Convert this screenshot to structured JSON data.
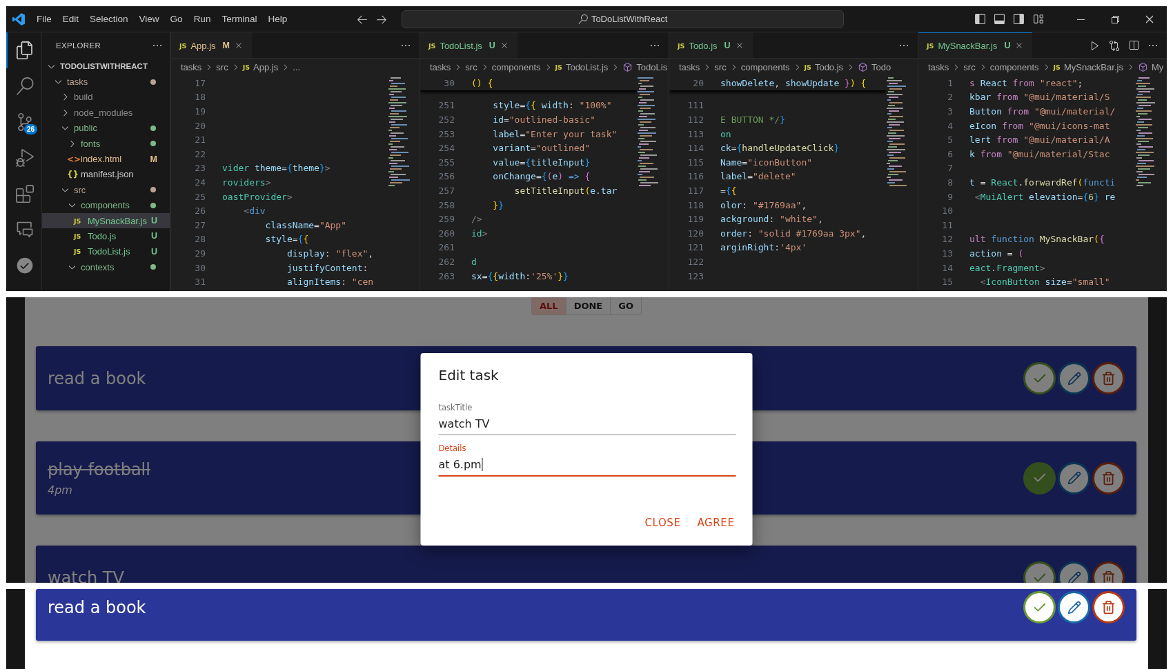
{
  "title_bar": {
    "menu": [
      "File",
      "Edit",
      "Selection",
      "View",
      "Go",
      "Run",
      "Terminal",
      "Help"
    ],
    "search": "ToDoListWithReact"
  },
  "activity_bar": {
    "items": [
      {
        "kind": "explorer",
        "selected": true
      },
      {
        "kind": "search",
        "selected": false
      },
      {
        "kind": "source-control",
        "selected": false,
        "badge": "26"
      },
      {
        "kind": "run",
        "selected": false
      },
      {
        "kind": "extensions",
        "selected": false
      },
      {
        "kind": "remote",
        "selected": false
      },
      {
        "kind": "testing",
        "selected": false
      }
    ]
  },
  "explorer": {
    "title": "EXPLORER",
    "tree": [
      {
        "label": "TODOLISTWITHREACT",
        "kind": "root",
        "expanded": true,
        "selected": false,
        "children": [
          {
            "label": "tasks",
            "kind": "folder",
            "expanded": true,
            "selected": false,
            "dot": true,
            "color": "#b8a394",
            "children": [
              {
                "label": "build",
                "kind": "folder",
                "expanded": false,
                "selected": false,
                "color": "#8c8c8c"
              },
              {
                "label": "node_modules",
                "kind": "folder",
                "expanded": false,
                "selected": false,
                "color": "#8c8c8c"
              },
              {
                "label": "public",
                "kind": "folder",
                "expanded": true,
                "selected": false,
                "dot": true,
                "color": "#81b88b",
                "children": [
                  {
                    "label": "fonts",
                    "kind": "folder",
                    "expanded": false,
                    "selected": false,
                    "dot": true,
                    "color": "#81b88b"
                  },
                  {
                    "label": "index.html",
                    "kind": "html",
                    "glyph": "<>",
                    "selected": false,
                    "badge": "M",
                    "color": "#e2c08d"
                  },
                  {
                    "label": "manifest.json",
                    "kind": "json",
                    "glyph": "{}",
                    "selected": false,
                    "color": "#cccccc"
                  }
                ]
              },
              {
                "label": "src",
                "kind": "folder",
                "expanded": true,
                "selected": false,
                "dot": true,
                "color": "#b8a394",
                "children": [
                  {
                    "label": "components",
                    "kind": "folder",
                    "expanded": true,
                    "selected": false,
                    "dot": true,
                    "color": "#81b88b",
                    "children": [
                      {
                        "label": "MySnackBar.js",
                        "kind": "js",
                        "glyph": "JS",
                        "selected": true,
                        "badge": "U",
                        "color": "#73c991"
                      },
                      {
                        "label": "Todo.js",
                        "kind": "js",
                        "glyph": "JS",
                        "selected": false,
                        "badge": "U",
                        "color": "#73c991"
                      },
                      {
                        "label": "TodoList.js",
                        "kind": "js",
                        "glyph": "JS",
                        "selected": false,
                        "badge": "U",
                        "color": "#73c991"
                      }
                    ]
                  },
                  {
                    "label": "contexts",
                    "kind": "folder",
                    "expanded": true,
                    "selected": false,
                    "dot": true,
                    "color": "#81b88b"
                  }
                ]
              }
            ]
          }
        ]
      }
    ]
  },
  "editor_groups": [
    {
      "focused": false,
      "tab": {
        "glyph": "JS",
        "label": "App.js",
        "badge": "M",
        "color": "#e2c08d",
        "selected": true
      },
      "actions": [
        {
          "kind": "more"
        }
      ],
      "breadcrumbs": [
        {
          "label": "tasks",
          "kind": "folder"
        },
        {
          "label": "src",
          "kind": "folder"
        },
        {
          "label": "App.js",
          "kind": "file",
          "glyph": "JS"
        },
        {
          "label": "...",
          "kind": "more"
        }
      ],
      "lines": [
        {
          "number": "17"
        },
        {
          "number": "18"
        },
        {
          "number": "19"
        },
        {
          "number": "20"
        },
        {
          "number": "21"
        },
        {
          "number": "22"
        },
        {
          "number": "23",
          "tokens": [
            {
              "text": "vider",
              "kind": "type"
            },
            {
              "text": " theme",
              "kind": "var"
            },
            {
              "text": "=",
              "kind": "plain"
            },
            {
              "text": "{",
              "kind": "brace3"
            },
            {
              "text": "theme",
              "kind": "var"
            },
            {
              "text": "}",
              "kind": "brace3"
            },
            {
              "text": ">",
              "kind": "punct"
            }
          ]
        },
        {
          "number": "24",
          "tokens": [
            {
              "text": "roviders",
              "kind": "type"
            },
            {
              "text": ">",
              "kind": "punct"
            }
          ]
        },
        {
          "number": "25",
          "tokens": [
            {
              "text": "oastProvider",
              "kind": "type"
            },
            {
              "text": ">",
              "kind": "punct"
            }
          ]
        },
        {
          "number": "26",
          "tokens": [
            {
              "text": "    <",
              "kind": "punct"
            },
            {
              "text": "div",
              "kind": "tag"
            }
          ]
        },
        {
          "number": "27",
          "tokens": [
            {
              "text": "        className",
              "kind": "var"
            },
            {
              "text": "=",
              "kind": "plain"
            },
            {
              "text": "\"App\"",
              "kind": "str"
            }
          ]
        },
        {
          "number": "28",
          "tokens": [
            {
              "text": "        style",
              "kind": "var"
            },
            {
              "text": "=",
              "kind": "plain"
            },
            {
              "text": "{",
              "kind": "brace3"
            },
            {
              "text": "{",
              "kind": "brace1"
            }
          ]
        },
        {
          "number": "29",
          "tokens": [
            {
              "text": "            display",
              "kind": "var"
            },
            {
              "text": ": ",
              "kind": "plain"
            },
            {
              "text": "\"flex\"",
              "kind": "str"
            },
            {
              "text": ",",
              "kind": "plain"
            }
          ]
        },
        {
          "number": "30",
          "tokens": [
            {
              "text": "            justifyContent",
              "kind": "var"
            },
            {
              "text": ":",
              "kind": "plain"
            }
          ]
        },
        {
          "number": "31",
          "tokens": [
            {
              "text": "            alignItems",
              "kind": "var"
            },
            {
              "text": ": ",
              "kind": "plain"
            },
            {
              "text": "\"cen",
              "kind": "str"
            }
          ]
        }
      ]
    },
    {
      "focused": false,
      "tab": {
        "glyph": "JS",
        "label": "TodoList.js",
        "badge": "U",
        "color": "#73c991",
        "selected": true
      },
      "actions": [
        {
          "kind": "more"
        }
      ],
      "breadcrumbs": [
        {
          "label": "tasks",
          "kind": "folder"
        },
        {
          "label": "src",
          "kind": "folder"
        },
        {
          "label": "components",
          "kind": "folder"
        },
        {
          "label": "TodoList.js",
          "kind": "file",
          "glyph": "JS"
        },
        {
          "label": "TodoLis",
          "kind": "symbol"
        }
      ],
      "sticky_line": {
        "number": "30",
        "tokens": [
          {
            "text": "() {",
            "kind": "brace1"
          }
        ]
      },
      "lines": [
        {
          "number": "251",
          "tokens": [
            {
              "text": "    style",
              "kind": "var"
            },
            {
              "text": "=",
              "kind": "plain"
            },
            {
              "text": "{",
              "kind": "brace3"
            },
            {
              "text": "{",
              "kind": "brace1"
            },
            {
              "text": " width",
              "kind": "var"
            },
            {
              "text": ": ",
              "kind": "plain"
            },
            {
              "text": "\"100%\"",
              "kind": "str"
            }
          ]
        },
        {
          "number": "252",
          "tokens": [
            {
              "text": "    id",
              "kind": "var"
            },
            {
              "text": "=",
              "kind": "plain"
            },
            {
              "text": "\"outlined-basic\"",
              "kind": "str"
            }
          ]
        },
        {
          "number": "253",
          "tokens": [
            {
              "text": "    label",
              "kind": "var"
            },
            {
              "text": "=",
              "kind": "plain"
            },
            {
              "text": "\"Enter your task\"",
              "kind": "str"
            }
          ]
        },
        {
          "number": "254",
          "tokens": [
            {
              "text": "    variant",
              "kind": "var"
            },
            {
              "text": "=",
              "kind": "plain"
            },
            {
              "text": "\"outlined\"",
              "kind": "str"
            }
          ]
        },
        {
          "number": "255",
          "tokens": [
            {
              "text": "    value",
              "kind": "var"
            },
            {
              "text": "=",
              "kind": "plain"
            },
            {
              "text": "{",
              "kind": "brace3"
            },
            {
              "text": "titleInput",
              "kind": "var"
            },
            {
              "text": "}",
              "kind": "brace3"
            }
          ]
        },
        {
          "number": "256",
          "tokens": [
            {
              "text": "    onChange",
              "kind": "var"
            },
            {
              "text": "=",
              "kind": "plain"
            },
            {
              "text": "{",
              "kind": "brace3"
            },
            {
              "text": "(",
              "kind": "brace2"
            },
            {
              "text": "e",
              "kind": "var"
            },
            {
              "text": ")",
              "kind": "brace2"
            },
            {
              "text": " => ",
              "kind": "kw2"
            },
            {
              "text": "{",
              "kind": "brace2"
            }
          ]
        },
        {
          "number": "257",
          "tokens": [
            {
              "text": "        setTitleInput",
              "kind": "fn"
            },
            {
              "text": "(",
              "kind": "brace1"
            },
            {
              "text": "e.tar",
              "kind": "var"
            }
          ]
        },
        {
          "number": "258",
          "tokens": [
            {
              "text": "    }",
              "kind": "brace1"
            },
            {
              "text": "}",
              "kind": "brace3"
            }
          ]
        },
        {
          "number": "259",
          "tokens": [
            {
              "text": "/>",
              "kind": "punct"
            }
          ]
        },
        {
          "number": "260",
          "tokens": [
            {
              "text": "id",
              "kind": "type"
            },
            {
              "text": ">",
              "kind": "punct"
            }
          ]
        },
        {
          "number": "261"
        },
        {
          "number": "262",
          "tokens": [
            {
              "text": "d",
              "kind": "type"
            }
          ]
        },
        {
          "number": "263",
          "tokens": [
            {
              "text": "sx",
              "kind": "var"
            },
            {
              "text": "=",
              "kind": "plain"
            },
            {
              "text": "{",
              "kind": "brace3"
            },
            {
              "text": "{",
              "kind": "brace1"
            },
            {
              "text": "width",
              "kind": "var"
            },
            {
              "text": ":",
              "kind": "plain"
            },
            {
              "text": "'25%'",
              "kind": "str"
            },
            {
              "text": "}",
              "kind": "brace1"
            },
            {
              "text": "}",
              "kind": "brace3"
            }
          ]
        }
      ]
    },
    {
      "focused": false,
      "tab": {
        "glyph": "JS",
        "label": "Todo.js",
        "badge": "U",
        "color": "#73c991",
        "selected": true
      },
      "actions": [
        {
          "kind": "more"
        }
      ],
      "breadcrumbs": [
        {
          "label": "tasks",
          "kind": "folder"
        },
        {
          "label": "src",
          "kind": "folder"
        },
        {
          "label": "components",
          "kind": "folder"
        },
        {
          "label": "Todo.js",
          "kind": "file",
          "glyph": "JS"
        },
        {
          "label": "Todo",
          "kind": "symbol"
        }
      ],
      "sticky_line": {
        "number": "20",
        "tokens": [
          {
            "text": "showDelete",
            "kind": "var"
          },
          {
            "text": ", ",
            "kind": "plain"
          },
          {
            "text": "showUpdate",
            "kind": "var"
          },
          {
            "text": " }",
            "kind": "brace2"
          },
          {
            "text": ") {",
            "kind": "brace1"
          }
        ]
      },
      "lines": [
        {
          "number": "111"
        },
        {
          "number": "112",
          "tokens": [
            {
              "text": "E BUTTON */",
              "kind": "comment"
            },
            {
              "text": "}",
              "kind": "brace3"
            }
          ]
        },
        {
          "number": "113",
          "tokens": [
            {
              "text": "on",
              "kind": "type"
            }
          ]
        },
        {
          "number": "114",
          "tokens": [
            {
              "text": "ck",
              "kind": "var"
            },
            {
              "text": "=",
              "kind": "plain"
            },
            {
              "text": "{",
              "kind": "brace3"
            },
            {
              "text": "handleUpdateClick",
              "kind": "fn"
            },
            {
              "text": "}",
              "kind": "brace3"
            }
          ]
        },
        {
          "number": "115",
          "tokens": [
            {
              "text": "Name",
              "kind": "var"
            },
            {
              "text": "=",
              "kind": "plain"
            },
            {
              "text": "\"iconButton\"",
              "kind": "str"
            }
          ]
        },
        {
          "number": "116",
          "tokens": [
            {
              "text": "label",
              "kind": "var"
            },
            {
              "text": "=",
              "kind": "plain"
            },
            {
              "text": "\"delete\"",
              "kind": "str"
            }
          ]
        },
        {
          "number": "117",
          "tokens": [
            {
              "text": "=",
              "kind": "plain"
            },
            {
              "text": "{",
              "kind": "brace3"
            },
            {
              "text": "{",
              "kind": "brace1"
            }
          ]
        },
        {
          "number": "118",
          "tokens": [
            {
              "text": "olor",
              "kind": "var"
            },
            {
              "text": ": ",
              "kind": "plain"
            },
            {
              "text": "\"#1769aa\"",
              "kind": "str"
            },
            {
              "text": ",",
              "kind": "plain"
            }
          ]
        },
        {
          "number": "119",
          "tokens": [
            {
              "text": "ackground",
              "kind": "var"
            },
            {
              "text": ": ",
              "kind": "plain"
            },
            {
              "text": "\"white\"",
              "kind": "str"
            },
            {
              "text": ",",
              "kind": "plain"
            }
          ]
        },
        {
          "number": "120",
          "tokens": [
            {
              "text": "order",
              "kind": "var"
            },
            {
              "text": ": ",
              "kind": "plain"
            },
            {
              "text": "\"solid #1769aa 3px\"",
              "kind": "str"
            },
            {
              "text": ",",
              "kind": "plain"
            }
          ]
        },
        {
          "number": "121",
          "tokens": [
            {
              "text": "arginRight",
              "kind": "var"
            },
            {
              "text": ":",
              "kind": "plain"
            },
            {
              "text": "'4px'",
              "kind": "str"
            }
          ]
        },
        {
          "number": "122"
        },
        {
          "number": "123"
        }
      ]
    },
    {
      "focused": true,
      "tab": {
        "glyph": "JS",
        "label": "MySnackBar.js",
        "badge": "U",
        "color": "#73c991",
        "selected": true
      },
      "actions": [
        {
          "kind": "run"
        },
        {
          "kind": "compare"
        },
        {
          "kind": "split"
        },
        {
          "kind": "more"
        }
      ],
      "breadcrumbs": [
        {
          "label": "tasks",
          "kind": "folder"
        },
        {
          "label": "src",
          "kind": "folder"
        },
        {
          "label": "components",
          "kind": "folder"
        },
        {
          "label": "MySnackBar.js",
          "kind": "file",
          "glyph": "JS"
        },
        {
          "label": "My",
          "kind": "symbol"
        }
      ],
      "lines": [
        {
          "number": "1",
          "tokens": [
            {
              "text": "s ",
              "kind": "kw"
            },
            {
              "text": "React",
              "kind": "var"
            },
            {
              "text": " from ",
              "kind": "kw"
            },
            {
              "text": "\"react\"",
              "kind": "str"
            },
            {
              "text": ";",
              "kind": "plain"
            }
          ]
        },
        {
          "number": "2",
          "tokens": [
            {
              "text": "kbar",
              "kind": "var"
            },
            {
              "text": " from ",
              "kind": "kw"
            },
            {
              "text": "\"@mui/material/S",
              "kind": "str"
            }
          ]
        },
        {
          "number": "3",
          "tokens": [
            {
              "text": "Button",
              "kind": "var"
            },
            {
              "text": " from ",
              "kind": "kw"
            },
            {
              "text": "\"@mui/material/",
              "kind": "str"
            }
          ]
        },
        {
          "number": "4",
          "tokens": [
            {
              "text": "eIcon",
              "kind": "var"
            },
            {
              "text": " from ",
              "kind": "kw"
            },
            {
              "text": "\"@mui/icons-mat",
              "kind": "str"
            }
          ]
        },
        {
          "number": "5",
          "tokens": [
            {
              "text": "lert",
              "kind": "var"
            },
            {
              "text": " from ",
              "kind": "kw"
            },
            {
              "text": "\"@mui/material/A",
              "kind": "str"
            }
          ]
        },
        {
          "number": "6",
          "tokens": [
            {
              "text": "k",
              "kind": "var"
            },
            {
              "text": " from ",
              "kind": "kw"
            },
            {
              "text": "\"@mui/material/Stac",
              "kind": "str"
            }
          ]
        },
        {
          "number": "7"
        },
        {
          "number": "8",
          "tokens": [
            {
              "text": "t",
              "kind": "var"
            },
            {
              "text": " = ",
              "kind": "plain"
            },
            {
              "text": "React",
              "kind": "type"
            },
            {
              "text": ".",
              "kind": "plain"
            },
            {
              "text": "forwardRef",
              "kind": "fn"
            },
            {
              "text": "(",
              "kind": "brace1"
            },
            {
              "text": "functi",
              "kind": "kw2"
            }
          ]
        },
        {
          "number": "9",
          "tokens": [
            {
              "text": " <",
              "kind": "punct"
            },
            {
              "text": "MuiAlert",
              "kind": "type"
            },
            {
              "text": " elevation",
              "kind": "var"
            },
            {
              "text": "=",
              "kind": "plain"
            },
            {
              "text": "{",
              "kind": "brace3"
            },
            {
              "text": "6",
              "kind": "num"
            },
            {
              "text": "}",
              "kind": "brace3"
            },
            {
              "text": " re",
              "kind": "var"
            }
          ]
        },
        {
          "number": "10"
        },
        {
          "number": "11"
        },
        {
          "number": "12",
          "tokens": [
            {
              "text": "ult ",
              "kind": "kw"
            },
            {
              "text": "function ",
              "kind": "kw2"
            },
            {
              "text": "MySnackBar",
              "kind": "fn"
            },
            {
              "text": "(",
              "kind": "brace1"
            },
            {
              "text": "{",
              "kind": "brace2"
            }
          ]
        },
        {
          "number": "13",
          "tokens": [
            {
              "text": "action",
              "kind": "var"
            },
            {
              "text": " = ",
              "kind": "plain"
            },
            {
              "text": "(",
              "kind": "brace2"
            }
          ]
        },
        {
          "number": "14",
          "tokens": [
            {
              "text": "eact",
              "kind": "type"
            },
            {
              "text": ".",
              "kind": "plain"
            },
            {
              "text": "Fragment",
              "kind": "type"
            },
            {
              "text": ">",
              "kind": "punct"
            }
          ]
        },
        {
          "number": "15",
          "tokens": [
            {
              "text": "  <",
              "kind": "punct"
            },
            {
              "text": "IconButton",
              "kind": "type"
            },
            {
              "text": " size",
              "kind": "var"
            },
            {
              "text": "=",
              "kind": "plain"
            },
            {
              "text": "\"small\"",
              "kind": "str"
            }
          ]
        }
      ]
    }
  ],
  "todo_app": {
    "filters": [
      {
        "label": "ALL",
        "selected": true
      },
      {
        "label": "DONE",
        "selected": false
      },
      {
        "label": "GO",
        "selected": false
      }
    ],
    "todos": [
      {
        "title": "read a book",
        "done": false
      },
      {
        "title": "play football",
        "details": "4pm",
        "done": true
      },
      {
        "title": "watch TV",
        "done": false
      }
    ],
    "dialog": {
      "title": "Edit task",
      "fields": [
        {
          "label": "taskTitle",
          "value": "watch TV",
          "focused": false
        },
        {
          "label": "Details",
          "value": "at 6.pm",
          "focused": true
        }
      ],
      "buttons": [
        "CLOSE",
        "AGREE"
      ]
    }
  },
  "todo_app_lower": {
    "todos": [
      {
        "title": "read a book",
        "done": false
      }
    ]
  }
}
